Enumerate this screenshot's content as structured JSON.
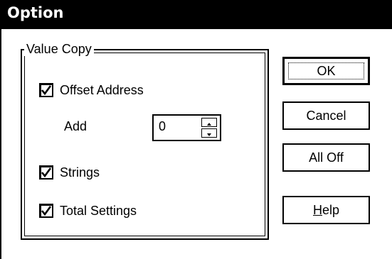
{
  "window": {
    "title": "Option"
  },
  "group": {
    "legend": "Value Copy",
    "offset_address": {
      "label": "Offset Address",
      "checked": true
    },
    "add": {
      "label": "Add",
      "value": "0"
    },
    "strings": {
      "label": "Strings",
      "checked": true
    },
    "total_settings": {
      "label": "Total Settings",
      "checked": true
    }
  },
  "buttons": {
    "ok": "OK",
    "cancel": "Cancel",
    "all_off": "All Off",
    "help_mnemonic": "H",
    "help_rest": "elp"
  },
  "icons": {
    "checkmark": "checkmark-icon",
    "spin_up": "arrow-up-icon",
    "spin_down": "arrow-down-icon"
  }
}
